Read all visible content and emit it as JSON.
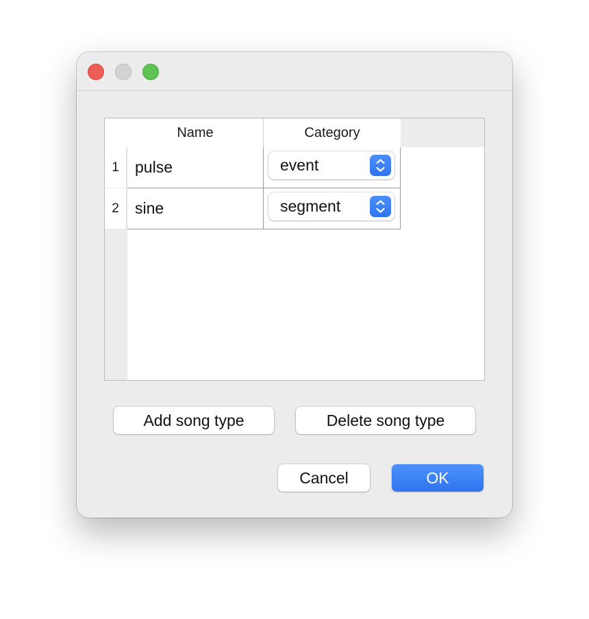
{
  "window": {
    "controls": {
      "close_icon": "close-icon",
      "minimize_icon": "minimize-icon",
      "maximize_icon": "maximize-icon"
    }
  },
  "table": {
    "columns": [
      "Name",
      "Category"
    ],
    "rows": [
      {
        "index": "1",
        "name": "pulse",
        "category": "event"
      },
      {
        "index": "2",
        "name": "sine",
        "category": "segment"
      }
    ]
  },
  "actions": {
    "add_label": "Add song type",
    "delete_label": "Delete song type"
  },
  "dialog_buttons": {
    "cancel_label": "Cancel",
    "ok_label": "OK"
  },
  "colors": {
    "accent": "#3478f6",
    "close": "#ee5e56",
    "minimize": "#d3d3d3",
    "maximize": "#5fc453"
  }
}
